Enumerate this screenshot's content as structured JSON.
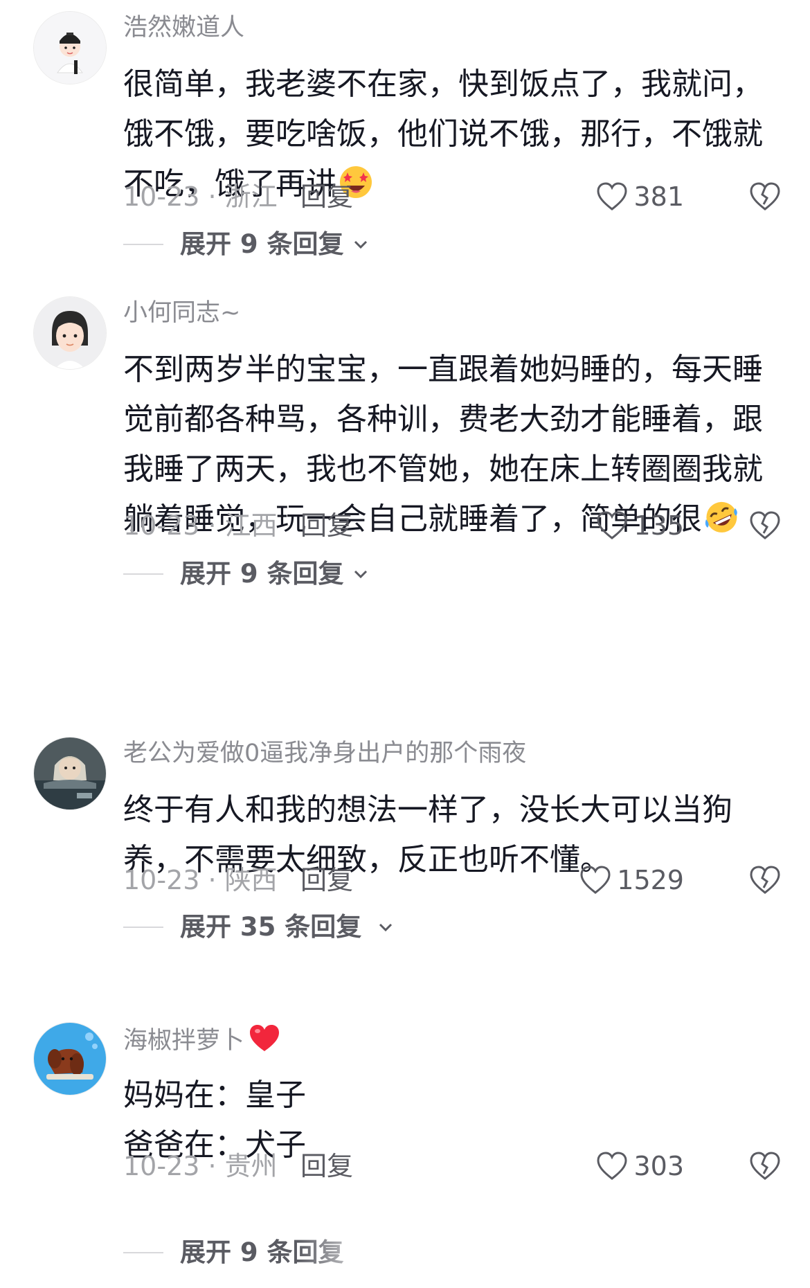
{
  "comments": [
    {
      "username": "浩然嫩道人",
      "lines": [
        "很简单，我老婆不在家，快到饭点了，我就问，",
        "饿不饿，要吃啥饭，他们说不饿，那行，不饿就",
        "不吃，饿了再讲"
      ],
      "emoji": "star-struck-face-emoji",
      "date_location": "10-23 · 浙江",
      "reply_label": "回复",
      "likes": "381",
      "expand_label": "展开 9 条回复"
    },
    {
      "username": "小何同志~",
      "lines": [
        "不到两岁半的宝宝，一直跟着她妈睡的，每天睡",
        "觉前都各种骂，各种训，费老大劲才能睡着，跟",
        "我睡了两天，我也不管她，她在床上转圈圈我就",
        "躺着睡觉，玩一会自己就睡着了，简单的很"
      ],
      "emoji": "rofl-face-emoji",
      "date_location": "10-23 · 江西",
      "reply_label": "回复",
      "likes": "135",
      "expand_label": "展开 9 条回复"
    },
    {
      "username": "老公为爱做0逼我净身出户的那个雨夜",
      "lines": [
        "终于有人和我的想法一样了，没长大可以当狗",
        "养，不需要太细致，反正也听不懂。"
      ],
      "emoji": "",
      "date_location": "10-23 · 陕西",
      "reply_label": "回复",
      "likes": "1529",
      "expand_label": "展开 35 条回复"
    },
    {
      "username": "海椒拌萝卜",
      "username_emoji": "red-heart-emoji",
      "lines": [
        "妈妈在：皇子",
        "爸爸在：犬子"
      ],
      "emoji": "",
      "date_location": "10-23 · 贵州",
      "reply_label": "回复",
      "likes": "303",
      "expand_label": "展开 9 条回复"
    }
  ],
  "icons": {
    "like": "heart-outline-icon",
    "dislike": "broken-heart-icon",
    "expand": "chevron-down-icon"
  },
  "colors": {
    "text": "#161823",
    "secondary": "#8a8b91",
    "muted": "#a3a4a8",
    "action": "#5a5b62"
  }
}
